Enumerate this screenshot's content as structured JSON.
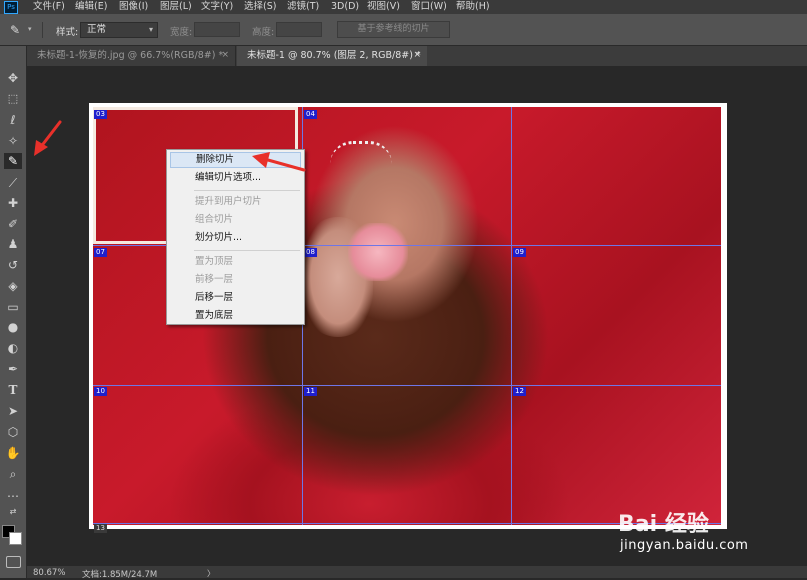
{
  "menubar": {
    "logo": "Ps",
    "items": [
      "文件(F)",
      "编辑(E)",
      "图像(I)",
      "图层(L)",
      "文字(Y)",
      "选择(S)",
      "滤镜(T)",
      "3D(D)",
      "视图(V)",
      "窗口(W)",
      "帮助(H)"
    ]
  },
  "options": {
    "style_label": "样式:",
    "style_value": "正常",
    "width_label": "宽度:",
    "height_label": "高度:",
    "align_button": "基于参考线的切片"
  },
  "tabs": [
    {
      "label": "未标题-1-恢复的.jpg @ 66.7%(RGB/8#) *",
      "close": "×"
    },
    {
      "label": "未标题-1 @ 80.7% (图层 2, RGB/8#) *",
      "close": "×"
    }
  ],
  "slices": {
    "tags": [
      "03",
      "04",
      "07",
      "08",
      "09",
      "10",
      "11",
      "12"
    ],
    "bottom_tag": "13"
  },
  "context_menu": {
    "items": [
      {
        "label": "删除切片",
        "enabled": true,
        "hover": true
      },
      {
        "label": "编辑切片选项...",
        "enabled": true
      },
      {
        "label": "提升到用户切片",
        "enabled": false
      },
      {
        "label": "组合切片",
        "enabled": false
      },
      {
        "label": "划分切片...",
        "enabled": true
      },
      {
        "label": "置为顶层",
        "enabled": false
      },
      {
        "label": "前移一层",
        "enabled": false
      },
      {
        "label": "后移一层",
        "enabled": true
      },
      {
        "label": "置为底层",
        "enabled": true
      }
    ]
  },
  "status": {
    "zoom": "80.67%",
    "doc": "文档:1.85M/24.7M",
    "arrow": "〉"
  },
  "watermark": {
    "logo": "Bai 经验",
    "url": "jingyan.baidu.com"
  },
  "colors": {
    "annotation_arrow": "#e8302a",
    "slice_tag_bg": "#1f1fcc",
    "slice_line": "#6e76e6"
  }
}
